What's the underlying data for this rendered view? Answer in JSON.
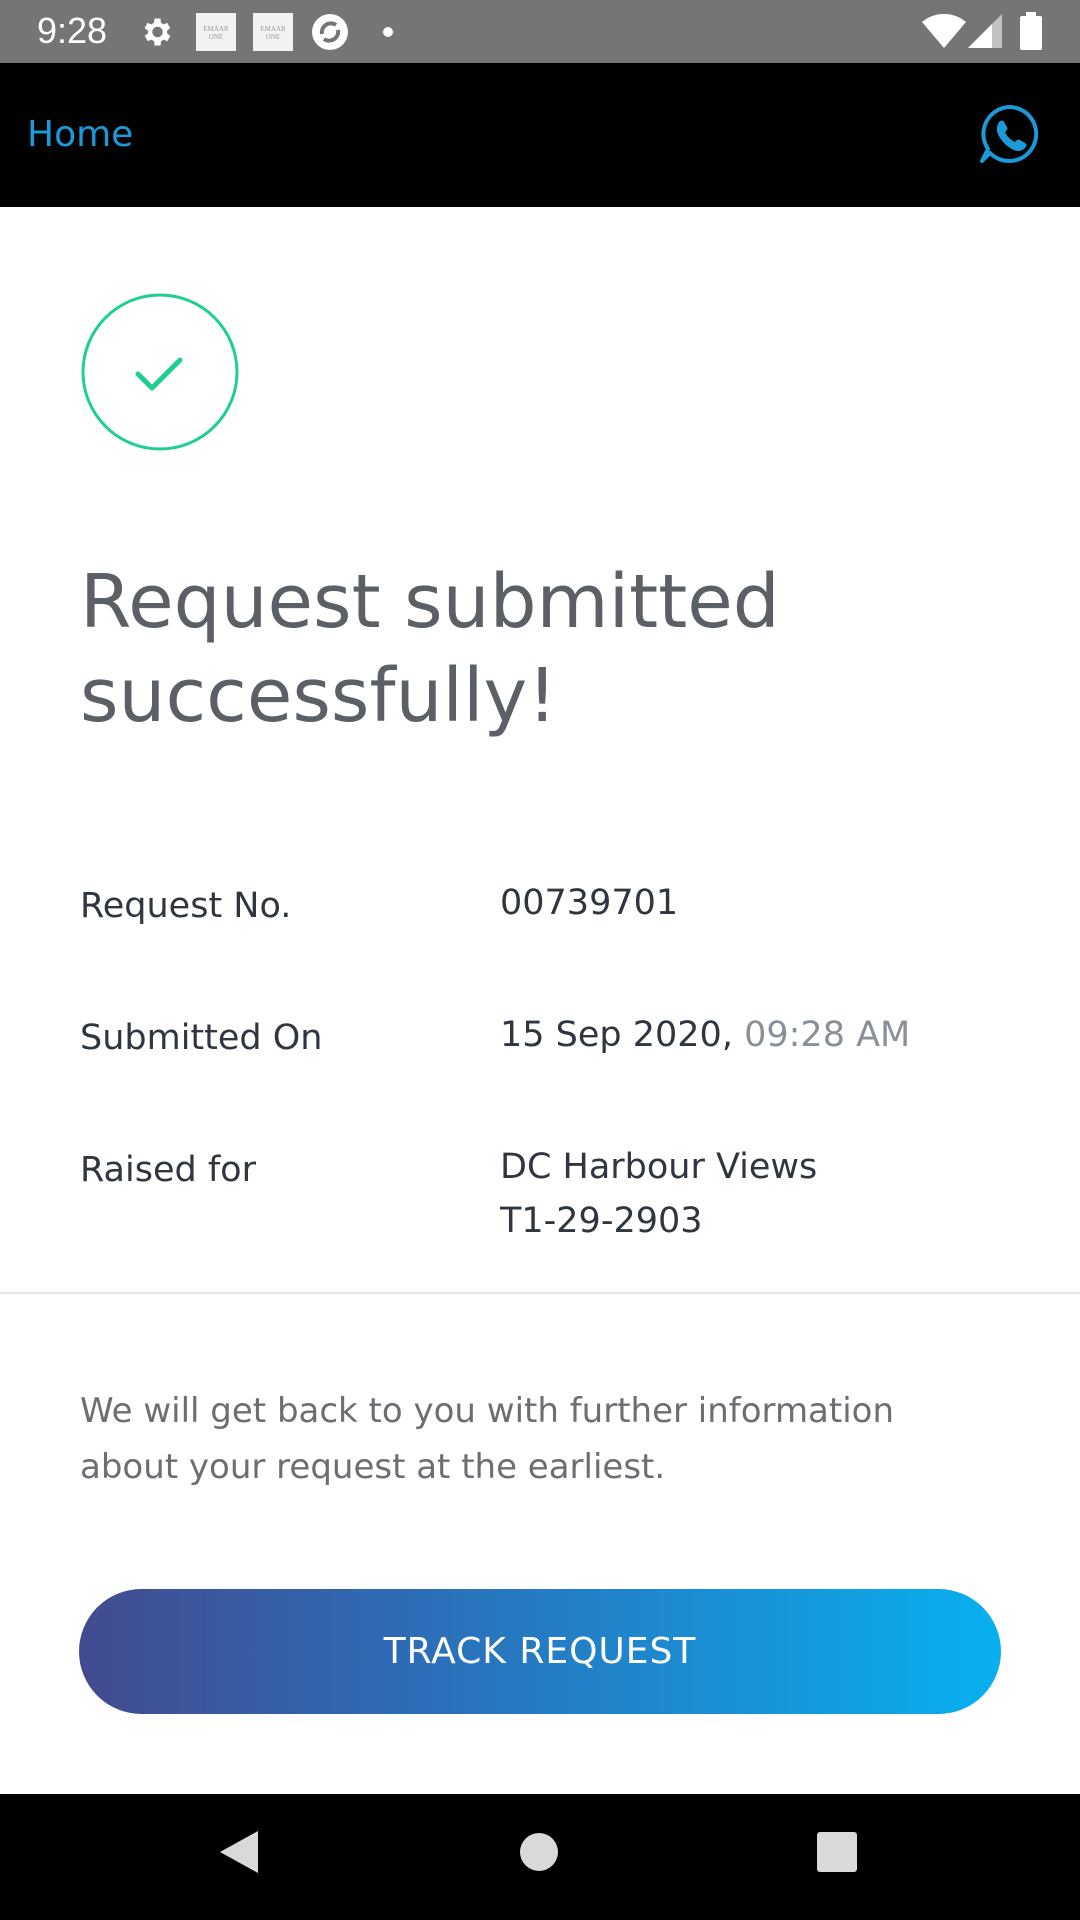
{
  "status_bar": {
    "time": "9:28",
    "icons": [
      "settings-icon",
      "emaar-one-icon",
      "emaar-one-icon",
      "sync-icon",
      "dot-icon",
      "wifi-icon",
      "signal-icon",
      "battery-icon"
    ],
    "emaar_label_1": "EMAAR ONE",
    "emaar_label_2": "EMAAR ONE"
  },
  "header": {
    "home_label": "Home",
    "whatsapp_icon": "whatsapp-icon",
    "accent_color": "#1a9ad9"
  },
  "main": {
    "success_icon": "check-circle-icon",
    "success_color": "#1fcf8f",
    "title": "Request submitted successfully!",
    "details": {
      "request_no_label": "Request No.",
      "request_no_value": "00739701",
      "submitted_on_label": "Submitted On",
      "submitted_on_date": "15 Sep 2020,",
      "submitted_on_time": "09:28 AM",
      "raised_for_label": "Raised for",
      "raised_for_line1": "DC Harbour Views",
      "raised_for_line2": "T1-29-2903"
    },
    "info_text": "We will get back to you with further information about your request at the earliest.",
    "track_button_label": "TRACK REQUEST"
  },
  "nav_bar": {
    "buttons": [
      "back-icon",
      "home-icon",
      "recents-icon"
    ]
  }
}
